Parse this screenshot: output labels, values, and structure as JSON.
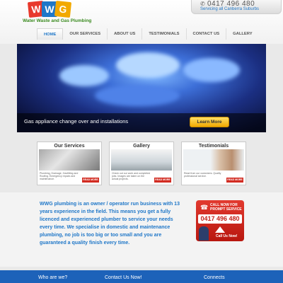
{
  "header": {
    "logo_letters": [
      "W",
      "W",
      "G"
    ],
    "logo_colors": [
      "#e8392c",
      "#1f77c8",
      "#f2a900"
    ],
    "tagline": "Water Waste and Gas Plumbing",
    "phone": "0417 496 480",
    "phone_sub": "Servicing all Canberra Suburbs",
    "phone_icon": "phone-icon"
  },
  "nav": [
    {
      "label": "HOME",
      "active": true
    },
    {
      "label": "OUR SERVICES",
      "active": false
    },
    {
      "label": "ABOUT US",
      "active": false
    },
    {
      "label": "TESTIMONIALS",
      "active": false
    },
    {
      "label": "CONTACT US",
      "active": false
    },
    {
      "label": "GALLERY",
      "active": false
    }
  ],
  "hero": {
    "caption": "Gas appliance change over and installations",
    "button": "Learn More"
  },
  "cards": [
    {
      "title": "Our Services",
      "text": "Plumbing, Drainage, Gasfitting and Roofing. Emergency repairs and maintenance.",
      "more": "READ MORE"
    },
    {
      "title": "Gallery",
      "text": "Check out our work and completed jobs. Images are taken on the actual projects.",
      "more": "READ MORE"
    },
    {
      "title": "Testimonials",
      "text": "Read from our customers. Quality professional service.",
      "more": "READ MORE"
    }
  ],
  "intro": {
    "text": "WWG plumbing is an owner / operator run business with 13 years experience in the field. This means you get a fully licenced and experienced plumber to service your needs every time. We specialise in domestic and maintenance plumbing, no job is too big or too small and you are guaranteed a quality finish every time."
  },
  "call": {
    "title": "CALL NOW FOR PROMPT SERVICE",
    "number": "0417 496 480",
    "cta": "Call Us Now!"
  },
  "footer": {
    "col1": "Who are we?",
    "col2": "Contact Us Now!",
    "col3": "Connects"
  }
}
